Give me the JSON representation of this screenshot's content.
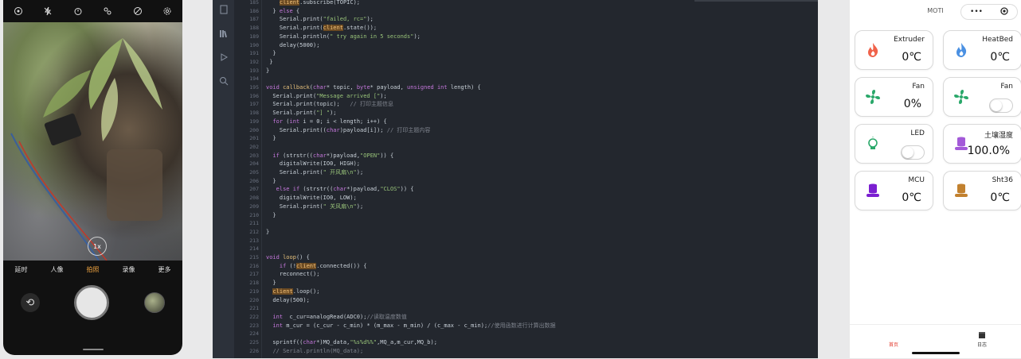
{
  "phone": {
    "modes": [
      "延时",
      "人像",
      "拍照",
      "录像",
      "更多"
    ],
    "zoom": "1x"
  },
  "editor": {
    "lines": [
      {
        "n": "185",
        "html": "    <span class=\"hl\">client</span>.subscribe(TOPIC);"
      },
      {
        "n": "186",
        "html": "  } <span class=\"kw\">else</span> {"
      },
      {
        "n": "187",
        "html": "    Serial.print(<span class=\"st\">\"failed, rc=\"</span>);"
      },
      {
        "n": "188",
        "html": "    Serial.print(<span class=\"hl\">client</span>.state());"
      },
      {
        "n": "189",
        "html": "    Serial.println(<span class=\"st\">\" try again in 5 seconds\"</span>);"
      },
      {
        "n": "190",
        "html": "    delay(5000);"
      },
      {
        "n": "191",
        "html": "  }"
      },
      {
        "n": "192",
        "html": " }"
      },
      {
        "n": "193",
        "html": "}"
      },
      {
        "n": "194",
        "html": ""
      },
      {
        "n": "195",
        "html": "<span class=\"kw\">void</span> <span class=\"fn\">callback</span>(<span class=\"kw\">char</span>* topic, <span class=\"kw\">byte</span>* payload, <span class=\"kw\">unsigned int</span> length) {"
      },
      {
        "n": "196",
        "html": "  Serial.print(<span class=\"st\">\"Message arrived [\"</span>);"
      },
      {
        "n": "197",
        "html": "  Serial.print(topic);   <span class=\"cm\">// 打印主题信息</span>"
      },
      {
        "n": "198",
        "html": "  Serial.print(<span class=\"st\">\"] \"</span>);"
      },
      {
        "n": "199",
        "html": "  <span class=\"kw\">for</span> (<span class=\"kw\">int</span> i = 0; i < length; i++) {"
      },
      {
        "n": "200",
        "html": "    Serial.print((<span class=\"kw\">char</span>)payload[i]); <span class=\"cm\">// 打印主题内容</span>"
      },
      {
        "n": "201",
        "html": "  }"
      },
      {
        "n": "202",
        "html": ""
      },
      {
        "n": "203",
        "html": "  <span class=\"kw\">if</span> (strstr((<span class=\"kw\">char</span>*)payload,<span class=\"st\">\"OPEN\"</span>)) {"
      },
      {
        "n": "204",
        "html": "    digitalWrite(IO0, HIGH);"
      },
      {
        "n": "205",
        "html": "    Serial.print(<span class=\"st\">\" 开风扇\\n\"</span>);"
      },
      {
        "n": "206",
        "html": "  }"
      },
      {
        "n": "207",
        "html": "   <span class=\"kw\">else if</span> (strstr((<span class=\"kw\">char</span>*)payload,<span class=\"st\">\"CLOS\"</span>)) {"
      },
      {
        "n": "208",
        "html": "    digitalWrite(IO0, LOW);"
      },
      {
        "n": "209",
        "html": "    Serial.print(<span class=\"st\">\" 关风扇\\n\"</span>);"
      },
      {
        "n": "210",
        "html": "  }"
      },
      {
        "n": "211",
        "html": ""
      },
      {
        "n": "212",
        "html": "}"
      },
      {
        "n": "213",
        "html": ""
      },
      {
        "n": "214",
        "html": ""
      },
      {
        "n": "215",
        "html": "<span class=\"kw\">void</span> <span class=\"fn\">loop</span>() {"
      },
      {
        "n": "216",
        "html": "    <span class=\"kw\">if</span> (!<span class=\"hl\">client</span>.connected()) {"
      },
      {
        "n": "217",
        "html": "    reconnect();"
      },
      {
        "n": "218",
        "html": "  }"
      },
      {
        "n": "219",
        "html": "  <span class=\"hl\">client</span>.loop();"
      },
      {
        "n": "220",
        "html": "  delay(500);"
      },
      {
        "n": "221",
        "html": ""
      },
      {
        "n": "222",
        "html": "  <span class=\"kw\">int</span>  c_cur=analogRead(ADC0);<span class=\"cm\">//读取温度数值</span>"
      },
      {
        "n": "223",
        "html": "  <span class=\"kw\">int</span> m_cur = (c_cur - c_min) * (m_max - m_min) / (c_max - c_min);<span class=\"cm\">//使用函数进行计算出数据</span>"
      },
      {
        "n": "224",
        "html": ""
      },
      {
        "n": "225",
        "html": "  sprintf((<span class=\"kw\">char</span>*)MQ_data,<span class=\"st\">\"%s%d%%\"</span>,MQ_a,m_cur,MQ_b);"
      },
      {
        "n": "226",
        "html": "  <span class=\"cm\">// Serial.println(MQ_data);</span>"
      }
    ]
  },
  "app": {
    "title": "MOTI",
    "capsule_dots": "•••",
    "cards": [
      {
        "label": "Extruder",
        "value": "0℃",
        "icon": "flame-icon",
        "color": "#f0624a",
        "toggle": false
      },
      {
        "label": "HeatBed",
        "value": "0℃",
        "icon": "flame-icon",
        "color": "#4a90e2",
        "toggle": false
      },
      {
        "label": "Fan",
        "value": "0%",
        "icon": "fan-icon",
        "color": "#2aa86a",
        "toggle": false
      },
      {
        "label": "Fan",
        "value": "",
        "icon": "fan-icon",
        "color": "#2aa86a",
        "toggle": true
      },
      {
        "label": "LED",
        "value": "",
        "icon": "bulb-icon",
        "color": "#2aa86a",
        "toggle": true
      },
      {
        "label": "土壤湿度",
        "value": "100.0%",
        "icon": "sensor-icon",
        "color": "#a35ad8",
        "toggle": false
      },
      {
        "label": "MCU",
        "value": "0℃",
        "icon": "sensor-icon",
        "color": "#7b1fd1",
        "toggle": false
      },
      {
        "label": "Sht36",
        "value": "0℃",
        "icon": "sensor-icon",
        "color": "#c2812f",
        "toggle": false
      }
    ],
    "tabs": {
      "home": "首页",
      "log": "日志"
    }
  }
}
